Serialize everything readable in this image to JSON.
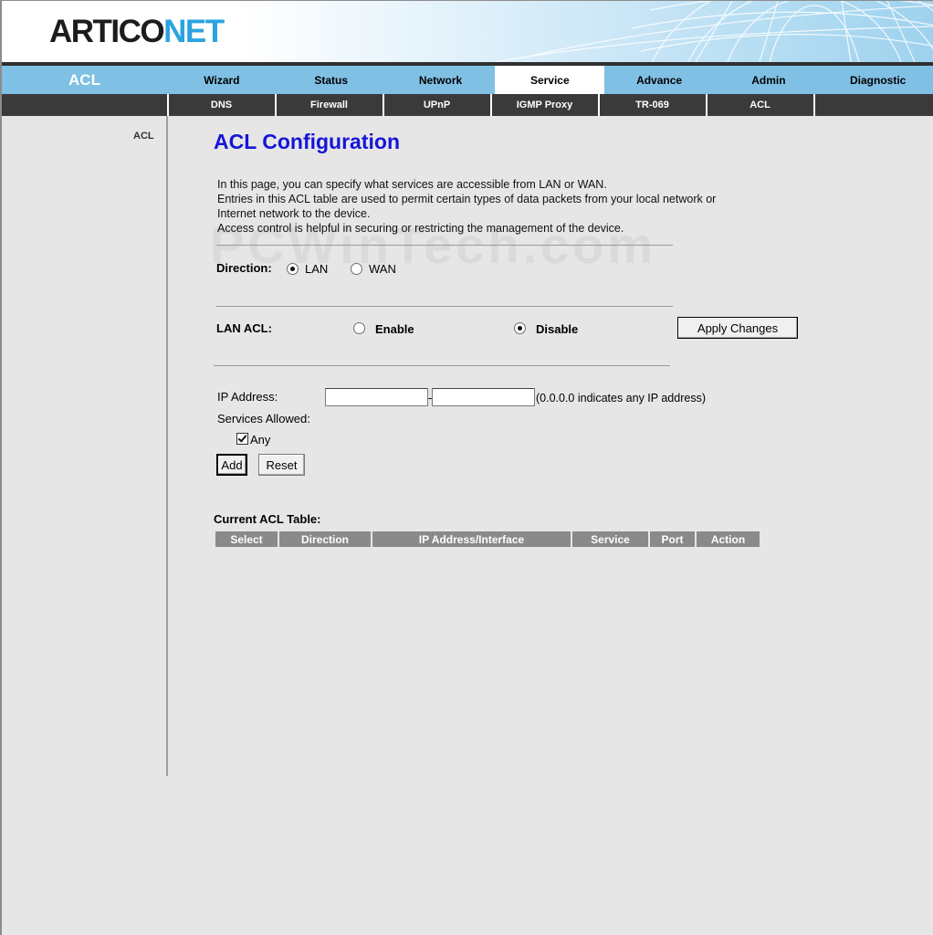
{
  "header": {
    "logo_part1": "ARTICO",
    "logo_part2": "NET"
  },
  "nav": {
    "section": "ACL",
    "tabs": [
      {
        "label": "Wizard"
      },
      {
        "label": "Status"
      },
      {
        "label": "Network"
      },
      {
        "label": "Service",
        "active": true
      },
      {
        "label": "Advance"
      },
      {
        "label": "Admin"
      },
      {
        "label": "Diagnostic"
      }
    ],
    "subtabs": [
      {
        "label": "DNS"
      },
      {
        "label": "Firewall"
      },
      {
        "label": "UPnP"
      },
      {
        "label": "IGMP Proxy"
      },
      {
        "label": "TR-069"
      },
      {
        "label": "ACL"
      }
    ]
  },
  "sidebar": {
    "items": [
      {
        "label": "ACL"
      }
    ]
  },
  "page": {
    "title": "ACL Configuration",
    "intro_lines": [
      "In this page, you can specify what services are accessible from LAN or WAN.",
      "Entries in this ACL table are used to permit certain types of data packets from your local network or",
      "Internet network to the device.",
      "Access control is helpful in securing or restricting the management of the device."
    ],
    "watermark": "PCWinTech.com"
  },
  "direction": {
    "label": "Direction:",
    "options": [
      {
        "label": "LAN",
        "selected": true
      },
      {
        "label": "WAN",
        "selected": false
      }
    ]
  },
  "lan_acl": {
    "label": "LAN ACL:",
    "options": [
      {
        "label": "Enable",
        "selected": false
      },
      {
        "label": "Disable",
        "selected": true
      }
    ],
    "apply_label": "Apply Changes"
  },
  "ip": {
    "label": "IP Address:",
    "start_value": "",
    "end_value": "",
    "separator": "-",
    "hint": "(0.0.0.0 indicates any IP address)"
  },
  "services": {
    "label": "Services Allowed:",
    "any_label": "Any",
    "any_checked": true
  },
  "buttons": {
    "add": "Add",
    "reset": "Reset"
  },
  "table": {
    "title": "Current ACL Table:",
    "columns": [
      "Select",
      "Direction",
      "IP Address/Interface",
      "Service",
      "Port",
      "Action"
    ]
  }
}
